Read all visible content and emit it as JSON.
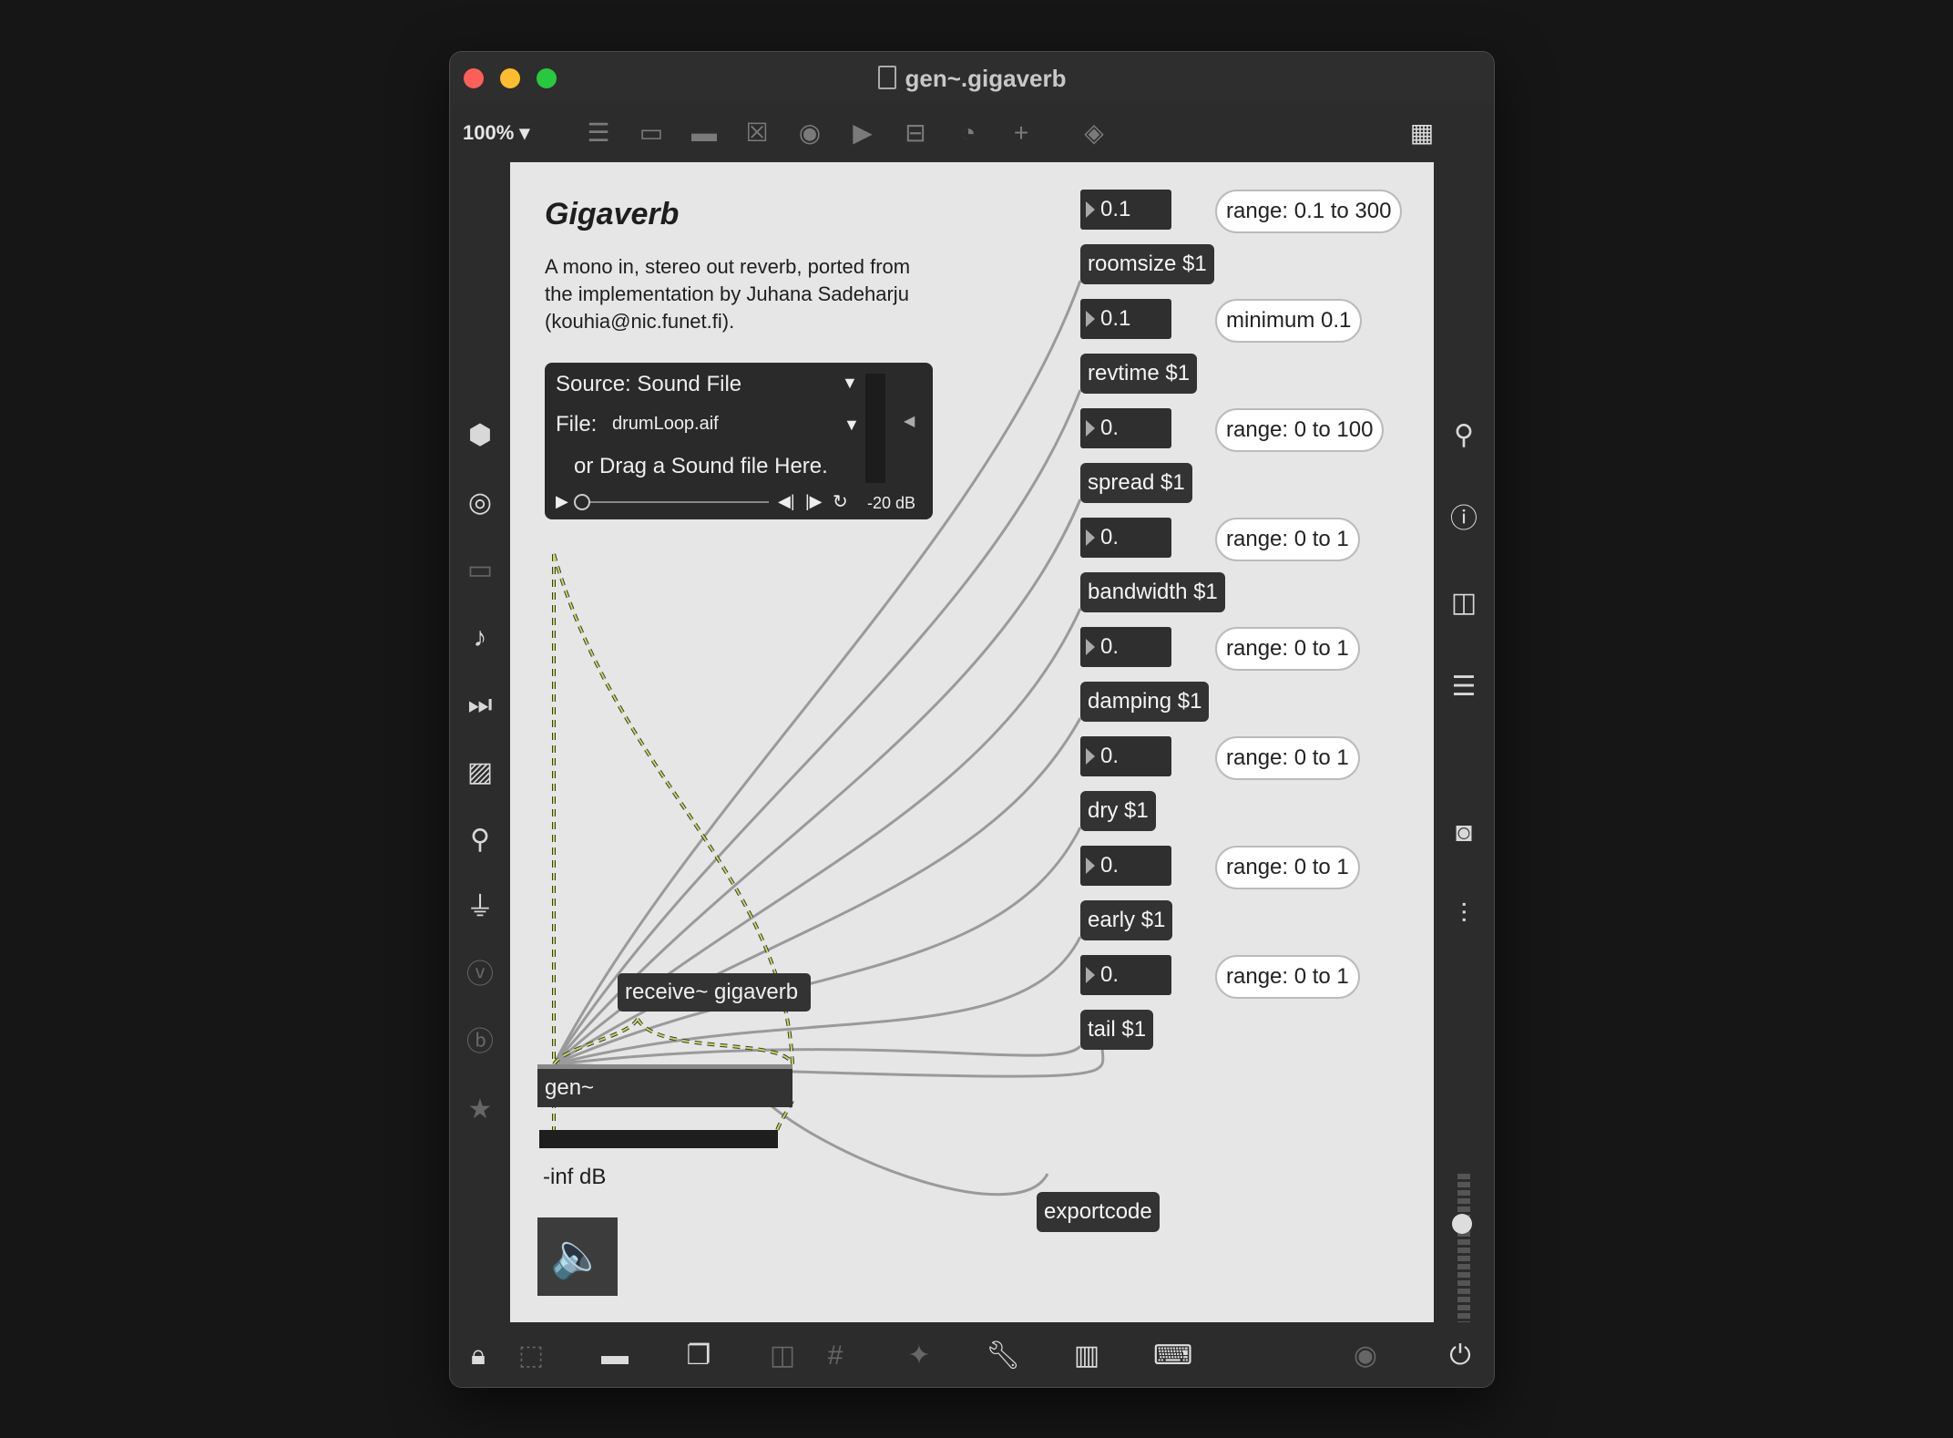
{
  "window": {
    "title": "gen~.gigaverb"
  },
  "toolbar": {
    "zoom": "100%"
  },
  "patcher": {
    "heading": "Gigaverb",
    "description_lines": [
      "A mono in, stereo out reverb, ported from",
      "the implementation by Juhana Sadeharju",
      "(kouhia@nic.funet.fi)."
    ],
    "player": {
      "source_label": "Source: Sound File",
      "file_label": "File:",
      "file_value": "drumLoop.aif",
      "drag_hint": "or Drag a Sound file Here.",
      "gain": "-20 dB"
    },
    "receive_object": "receive~ gigaverb",
    "gen_object": "gen~",
    "meter_readout": "-inf dB",
    "export_message": "exportcode",
    "params": [
      {
        "number": "0.1",
        "message": "roomsize $1",
        "comment": "range: 0.1 to 300"
      },
      {
        "number": "0.1",
        "message": "revtime $1",
        "comment": "minimum 0.1"
      },
      {
        "number": "0.",
        "message": "spread $1",
        "comment": "range: 0 to 100"
      },
      {
        "number": "0.",
        "message": "bandwidth $1",
        "comment": "range: 0 to 1"
      },
      {
        "number": "0.",
        "message": "damping $1",
        "comment": "range: 0 to 1"
      },
      {
        "number": "0.",
        "message": "dry $1",
        "comment": "range: 0 to 1"
      },
      {
        "number": "0.",
        "message": "early $1",
        "comment": "range: 0 to 1"
      },
      {
        "number": "0.",
        "message": "tail $1",
        "comment": "range: 0 to 1"
      }
    ]
  },
  "icons": {
    "left_sidebar": [
      "cube-icon",
      "target-icon",
      "presentation-icon",
      "music-note-icon",
      "media-icon",
      "image-icon",
      "paperclip-icon",
      "plug-icon",
      "v-icon",
      "b-icon",
      "star-icon"
    ],
    "right_sidebar": [
      "search-icon",
      "info-icon",
      "book-icon",
      "list-icon",
      "camera-icon",
      "mixer-icon"
    ],
    "bottom": [
      "lock-icon",
      "select-icon",
      "presentation-mode-icon",
      "windows-icon",
      "mute-icon",
      "grid-icon",
      "plugin-icon",
      "wrench-icon",
      "piano-icon",
      "keyboard-icon",
      "play-icon",
      "power-icon"
    ]
  },
  "colors": {
    "canvas": "#e6e6e6",
    "object": "#333333",
    "signal_wire": "#c8d85a"
  }
}
